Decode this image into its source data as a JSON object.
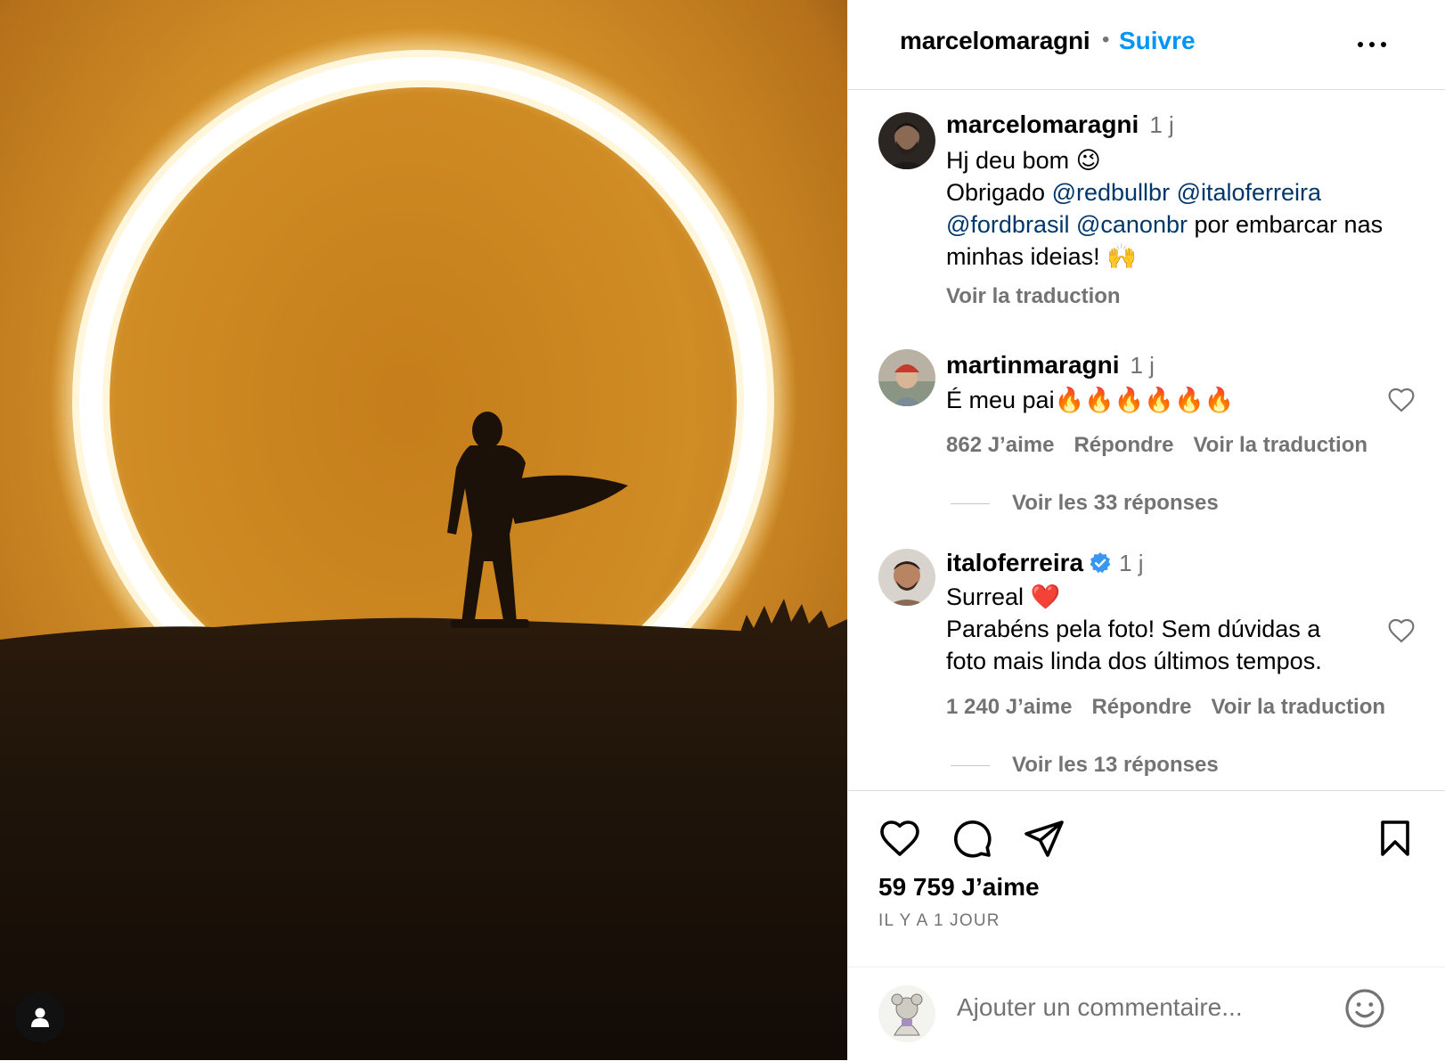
{
  "header": {
    "username": "marcelomaragni",
    "dot": "•",
    "follow_label": "Suivre"
  },
  "caption": {
    "username": "marcelomaragni",
    "time": "1 j",
    "line1": "Hj deu bom 😉",
    "obrigado": "Obrigado",
    "m1": "@redbullbr",
    "m2": "@italoferreira",
    "m3": "@fordbrasil",
    "m4": "@canonbr",
    "rest1": "por embarcar nas",
    "rest2": "minhas ideias! 🙌",
    "translate": "Voir la traduction"
  },
  "comments": [
    {
      "username": "martinmaragni",
      "time": "1 j",
      "text": "É meu pai🔥🔥🔥🔥🔥🔥",
      "likes": "862 J’aime",
      "reply": "Répondre",
      "translate": "Voir la traduction",
      "replies": "Voir les 33 réponses"
    },
    {
      "username": "italoferreira",
      "time": "1 j",
      "line1": "Surreal ❤️",
      "line2": "Parabéns pela foto! Sem dúvidas a",
      "line3": "foto mais linda dos últimos tempos.",
      "likes": "1 240 J’aime",
      "reply": "Répondre",
      "translate": "Voir la traduction",
      "replies": "Voir les 13 réponses"
    }
  ],
  "post": {
    "likes": "59 759 J’aime",
    "date": "IL Y A 1 JOUR"
  },
  "add_comment": {
    "placeholder": "Ajouter un commentaire..."
  },
  "colors": {
    "accent": "#0095f6",
    "mention": "#00376b",
    "muted": "#737373",
    "verified": "#3897f0"
  }
}
